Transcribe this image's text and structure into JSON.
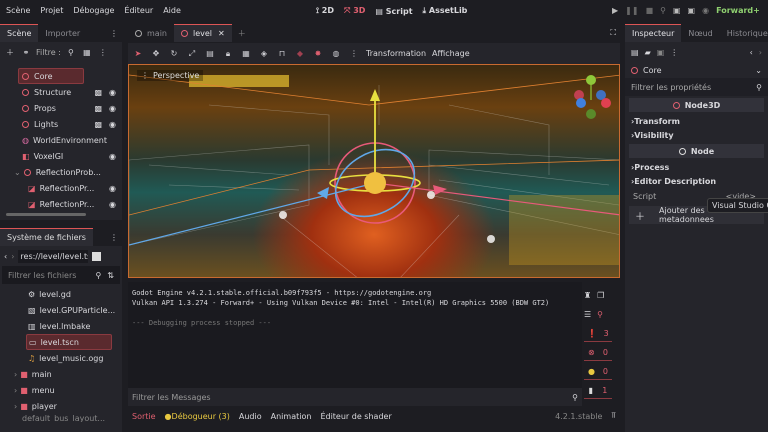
{
  "menu": [
    "Scène",
    "Projet",
    "Débogage",
    "Éditeur",
    "Aide"
  ],
  "workspaces": [
    {
      "icon": "2d-icon",
      "label": "2D"
    },
    {
      "icon": "3d-icon",
      "label": "3D"
    },
    {
      "icon": "script-icon",
      "label": "Script"
    },
    {
      "icon": "assetlib-icon",
      "label": "AssetLib"
    }
  ],
  "renderer": "Forward+",
  "scene_dock": {
    "tabs": [
      "Scène",
      "Importer"
    ],
    "filter": "Filtre :",
    "nodes": [
      {
        "name": "Core",
        "selected": true
      },
      {
        "name": "Structure"
      },
      {
        "name": "Props"
      },
      {
        "name": "Lights"
      },
      {
        "name": "WorldEnvironment"
      },
      {
        "name": "VoxelGI"
      },
      {
        "name": "ReflectionProb..."
      },
      {
        "name": "ReflectionPr..."
      },
      {
        "name": "ReflectionPr..."
      }
    ]
  },
  "filesystem": {
    "title": "Système de fichiers",
    "path": "res://level/level.tscn",
    "filter_placeholder": "Filtrer les fichiers",
    "items": [
      {
        "name": "level.gd",
        "type": "script"
      },
      {
        "name": "level.GPUParticle...",
        "type": "particles"
      },
      {
        "name": "level.lmbake",
        "type": "lightmap"
      },
      {
        "name": "level.tscn",
        "type": "scene",
        "selected": true
      },
      {
        "name": "level_music.ogg",
        "type": "audio"
      },
      {
        "name": "main",
        "type": "folder"
      },
      {
        "name": "menu",
        "type": "folder"
      },
      {
        "name": "player",
        "type": "folder"
      },
      {
        "name": "default_bus_layout...",
        "type": "file"
      }
    ]
  },
  "scene_tabs": [
    "main",
    "level"
  ],
  "viewport": {
    "menus": [
      "Transformation",
      "Affichage"
    ],
    "label": "Perspective"
  },
  "output": {
    "lines": [
      "Godot Engine v4.2.1.stable.official.b09f793f5 - https://godotengine.org",
      "Vulkan API 1.3.274 - Forward+ - Using Vulkan Device #0: Intel - Intel(R) HD Graphics 5500 (BDW GT2)",
      "",
      "--- Debugging process stopped ---"
    ],
    "filter_placeholder": "Filtrer les Messages",
    "counts": {
      "messages": "3",
      "errors": "0",
      "warnings": "0",
      "editor": "1"
    }
  },
  "bottom_tabs": [
    "Sortie",
    "Débogueur (3)",
    "Audio",
    "Animation",
    "Éditeur de shader"
  ],
  "version": "4.2.1.stable",
  "inspector": {
    "tabs": [
      "Inspecteur",
      "Nœud",
      "Historique"
    ],
    "node": "Core",
    "filter_placeholder": "Filtrer les propriétés",
    "class1": "Node3D",
    "sections1": [
      "Transform",
      "Visibility"
    ],
    "class2": "Node",
    "sections2": [
      "Process",
      "Editor Description"
    ],
    "script_label": "Script",
    "script_value": "<vide>",
    "tooltip": "Visual Studio Code",
    "add_meta": "Ajouter des metadonnees"
  },
  "colors": {
    "accent": "#e06070",
    "bg": "#1d1d22",
    "panel": "#25252b",
    "warning": "#e8c840"
  }
}
